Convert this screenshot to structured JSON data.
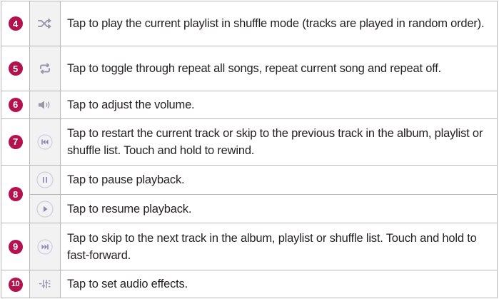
{
  "rows": [
    {
      "num": "4",
      "icon": "shuffle-icon",
      "text": "Tap to play the current playlist in shuffle mode (tracks are played in random order)."
    },
    {
      "num": "5",
      "icon": "repeat-icon",
      "text": "Tap to toggle through repeat all songs, repeat current song and repeat off."
    },
    {
      "num": "6",
      "icon": "volume-icon",
      "text": "Tap to adjust the volume."
    },
    {
      "num": "7",
      "icon": "previous-track-icon",
      "text": "Tap to restart the current track or skip to the previous track in the album, playlist or shuffle list. Touch and hold to rewind."
    },
    {
      "num": "8",
      "icon": "pause-icon",
      "text": "Tap to pause playback."
    },
    {
      "icon": "play-icon",
      "text": "Tap to resume playback."
    },
    {
      "num": "9",
      "icon": "next-track-icon",
      "text": "Tap to skip to the next track in the album, playlist or shuffle list. Touch and hold to fast-forward."
    },
    {
      "num": "10",
      "icon": "audio-effects-icon",
      "text": "Tap to set audio effects."
    }
  ],
  "colors": {
    "badge": "#b3124e",
    "icon": "#9a97a6",
    "icon_cell_bg": "#f2f2f2",
    "border": "#b8b8b8",
    "text": "#231f20"
  }
}
